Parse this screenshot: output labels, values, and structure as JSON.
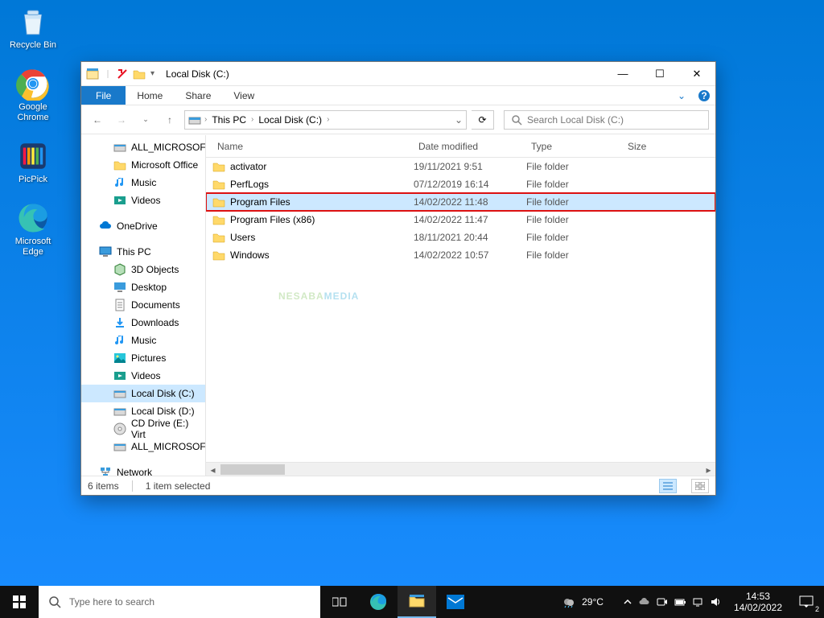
{
  "desktop": [
    {
      "name": "recycle-bin",
      "label": "Recycle Bin"
    },
    {
      "name": "google-chrome",
      "label": "Google\nChrome"
    },
    {
      "name": "picpick",
      "label": "PicPick"
    },
    {
      "name": "microsoft-edge",
      "label": "Microsoft\nEdge"
    }
  ],
  "taskbar": {
    "search_placeholder": "Type here to search",
    "weather_temp": "29°C",
    "clock_time": "14:53",
    "clock_date": "14/02/2022",
    "notif_count": "2"
  },
  "window": {
    "title": "Local Disk (C:)",
    "ribbon": {
      "file": "File",
      "tabs": [
        "Home",
        "Share",
        "View"
      ]
    },
    "breadcrumb": [
      "This PC",
      "Local Disk (C:)"
    ],
    "search_placeholder": "Search Local Disk (C:)",
    "nav": {
      "quick": [
        {
          "label": "ALL_MICROSOFT",
          "icon": "drive"
        },
        {
          "label": "Microsoft Office",
          "icon": "folder"
        },
        {
          "label": "Music",
          "icon": "music"
        },
        {
          "label": "Videos",
          "icon": "video"
        }
      ],
      "onedrive": "OneDrive",
      "thispc": "This PC",
      "thispc_items": [
        {
          "label": "3D Objects",
          "icon": "cube"
        },
        {
          "label": "Desktop",
          "icon": "desktop"
        },
        {
          "label": "Documents",
          "icon": "doc"
        },
        {
          "label": "Downloads",
          "icon": "download"
        },
        {
          "label": "Music",
          "icon": "music"
        },
        {
          "label": "Pictures",
          "icon": "picture"
        },
        {
          "label": "Videos",
          "icon": "video"
        },
        {
          "label": "Local Disk (C:)",
          "icon": "drive",
          "selected": true
        },
        {
          "label": "Local Disk (D:)",
          "icon": "drive"
        },
        {
          "label": "CD Drive (E:) Virt",
          "icon": "cd"
        },
        {
          "label": "ALL_MICROSOFT",
          "icon": "drive"
        }
      ],
      "network": "Network"
    },
    "columns": [
      "Name",
      "Date modified",
      "Type",
      "Size"
    ],
    "rows": [
      {
        "name": "activator",
        "date": "19/11/2021 9:51",
        "type": "File folder",
        "size": ""
      },
      {
        "name": "PerfLogs",
        "date": "07/12/2019 16:14",
        "type": "File folder",
        "size": ""
      },
      {
        "name": "Program Files",
        "date": "14/02/2022 11:48",
        "type": "File folder",
        "size": "",
        "selected": true
      },
      {
        "name": "Program Files (x86)",
        "date": "14/02/2022 11:47",
        "type": "File folder",
        "size": ""
      },
      {
        "name": "Users",
        "date": "18/11/2021 20:44",
        "type": "File folder",
        "size": ""
      },
      {
        "name": "Windows",
        "date": "14/02/2022 10:57",
        "type": "File folder",
        "size": ""
      }
    ],
    "status": {
      "items": "6 items",
      "selected": "1 item selected"
    },
    "watermark": {
      "a": "NESABA",
      "b": "MEDIA"
    }
  }
}
